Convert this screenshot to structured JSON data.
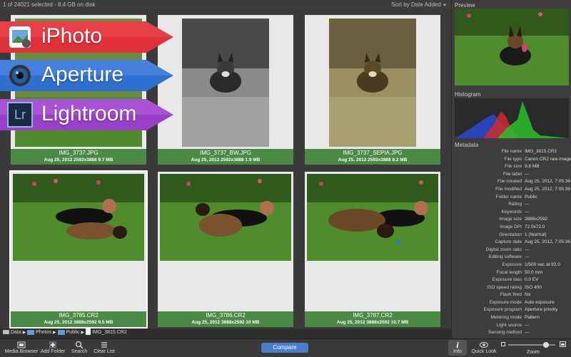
{
  "topbar": {
    "selection": "1 of 24021 selected - 8.4 GB on disk",
    "sort": "Sort by Date Added",
    "sort_caret": "▼"
  },
  "banners": [
    {
      "label": "iPhoto",
      "color": "#e0303a"
    },
    {
      "label": "Aperture",
      "color": "#2f6fd0"
    },
    {
      "label": "Lightroom",
      "color": "#9a3fc8",
      "icon_text": "Lr"
    }
  ],
  "photos": [
    {
      "name": "IMG_3737.JPG",
      "meta": "Aug 25, 2012   2592x3888   9.7 MB"
    },
    {
      "name": "IMG_3737_BW.JPG",
      "meta": "Aug 25, 2012   2592x3888   1.9 MB"
    },
    {
      "name": "IMG_3737_SEPIA.JPG",
      "meta": "Aug 25, 2012   2592x3888   8.2 MB"
    },
    {
      "name": "IMG_3785.CR2",
      "meta": "Aug 25, 2012   3888x2592   9.5 MB"
    },
    {
      "name": "IMG_3786.CR2",
      "meta": "Aug 25, 2012   3888x2592   10 MB"
    },
    {
      "name": "IMG_3787.CR2",
      "meta": "Aug 25, 2012   3888x2592   10.7 MB"
    }
  ],
  "right": {
    "preview_title": "Preview",
    "histogram_title": "Histogram",
    "metadata_title": "Metadata",
    "metadata": [
      [
        "File name",
        "IMG_3815.CR2"
      ],
      [
        "File type",
        "Canon CR2 raw image"
      ],
      [
        "File size",
        "9.8 MB"
      ],
      [
        "File label",
        "---"
      ],
      [
        "File created",
        "Aug 25, 2012, 7:05:36 PM"
      ],
      [
        "File modified",
        "Aug 25, 2012, 7:05:36 PM"
      ],
      [
        "Folder name",
        "Public"
      ],
      [
        "Rating",
        "---"
      ],
      [
        "Keywords",
        "---"
      ],
      [
        "Image size",
        "3888x2592"
      ],
      [
        "Image DPI",
        "72.0x72.0"
      ],
      [
        "Orientation",
        "1 (Normal)"
      ],
      [
        "Capture date",
        "Aug 25, 2012, 7:05:36 PM"
      ],
      [
        "Digital zoom ratio",
        "---"
      ],
      [
        "Editing software",
        "---"
      ],
      [
        "Exposure",
        "1/500 sec at f/2.0"
      ],
      [
        "Focal length",
        "50.0 mm"
      ],
      [
        "Exposure bias",
        "0.0 EV"
      ],
      [
        "ISO speed rating",
        "ISO 400"
      ],
      [
        "Flash fired",
        "No"
      ],
      [
        "Exposure mode",
        "Auto exposure"
      ],
      [
        "Exposure program",
        "Aperture priority"
      ],
      [
        "Metering mode",
        "Pattern"
      ],
      [
        "Light source",
        "---"
      ],
      [
        "Sensing method",
        "---"
      ]
    ]
  },
  "path": [
    "Data",
    "Photos",
    "Public",
    "IMG_3815.CR2"
  ],
  "path_sep": "▶",
  "toolbar": {
    "media_browser": "Media Browser",
    "add_folder": "Add Folder",
    "search": "Search",
    "clear_list": "Clear List",
    "compare": "Compare",
    "info": "Info",
    "quick_look": "Quick Look",
    "zoom": "Zoom",
    "zoom_level": 0.8
  },
  "colors": {
    "caption": "#4a8a45",
    "accent": "#4a7fd0"
  }
}
